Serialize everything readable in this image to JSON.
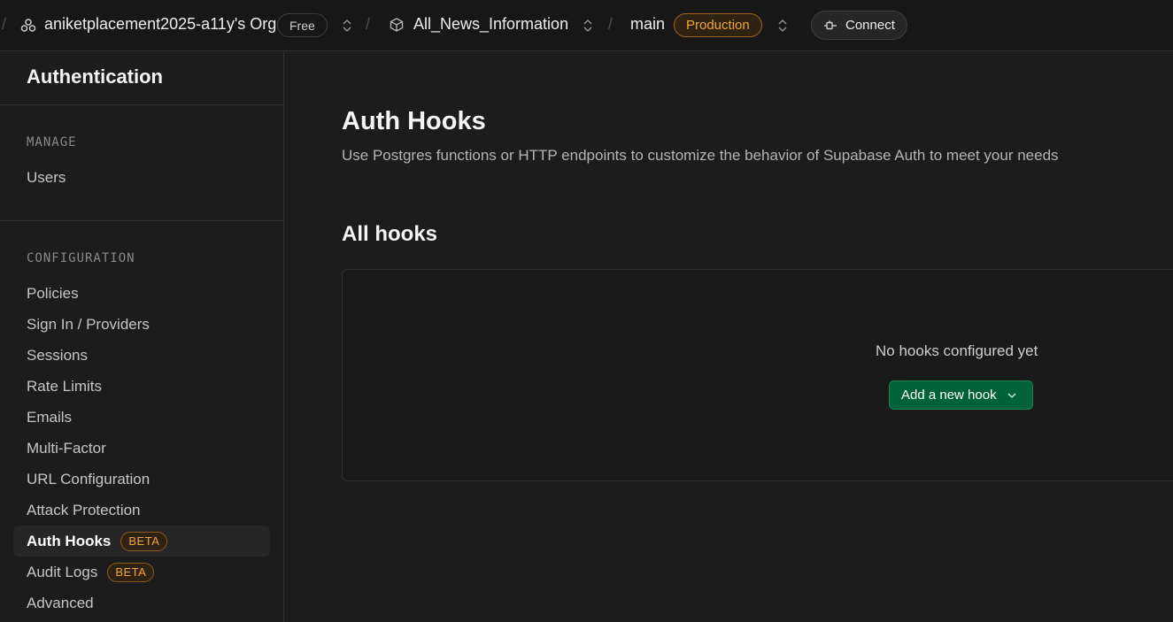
{
  "topbar": {
    "org_name": "aniketplacement2025-a11y's Org",
    "plan_badge": "Free",
    "project_name": "All_News_Information",
    "branch_name": "main",
    "env_badge": "Production",
    "connect_label": "Connect",
    "separator": "/",
    "icons": [
      "org-icon",
      "chevron-updown-icon",
      "project-cube-icon",
      "plug-icon"
    ]
  },
  "sidebar": {
    "title": "Authentication",
    "sections": [
      {
        "label": "MANAGE",
        "items": [
          {
            "label": "Users"
          }
        ]
      },
      {
        "label": "CONFIGURATION",
        "items": [
          {
            "label": "Policies"
          },
          {
            "label": "Sign In / Providers"
          },
          {
            "label": "Sessions"
          },
          {
            "label": "Rate Limits"
          },
          {
            "label": "Emails"
          },
          {
            "label": "Multi-Factor"
          },
          {
            "label": "URL Configuration"
          },
          {
            "label": "Attack Protection"
          },
          {
            "label": "Auth Hooks",
            "badge": "BETA",
            "active": true
          },
          {
            "label": "Audit Logs",
            "badge": "BETA"
          },
          {
            "label": "Advanced"
          }
        ]
      }
    ]
  },
  "main": {
    "title": "Auth Hooks",
    "description": "Use Postgres functions or HTTP endpoints to customize the behavior of Supabase Auth to meet your needs",
    "section_title": "All hooks",
    "empty_text": "No hooks configured yet",
    "add_button": "Add a new hook"
  },
  "colors": {
    "background": "#1c1c1c",
    "topbar": "#171717",
    "accent_green": "#006239",
    "badge_orange": "#f3a43c"
  }
}
